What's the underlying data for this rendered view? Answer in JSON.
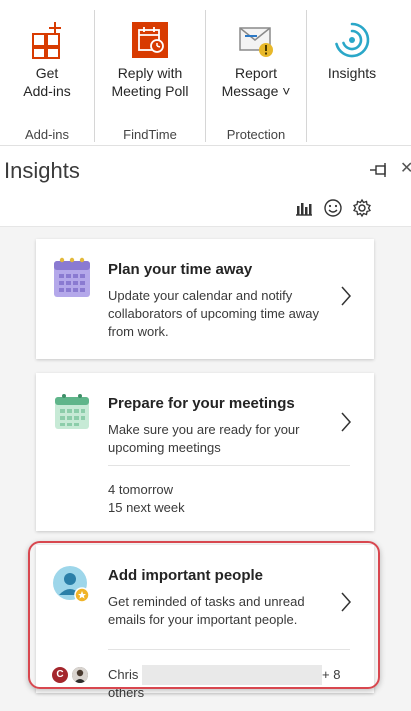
{
  "ribbon": {
    "groups": [
      {
        "label": "Add-ins",
        "buttons": [
          {
            "label": "Get\nAdd-ins",
            "icon": "get-addins-icon"
          }
        ]
      },
      {
        "label": "FindTime",
        "buttons": [
          {
            "label": "Reply with\nMeeting Poll",
            "icon": "meeting-poll-icon"
          }
        ]
      },
      {
        "label": "Protection",
        "buttons": [
          {
            "label": "Report\nMessage ˅",
            "icon": "report-message-icon"
          }
        ]
      },
      {
        "label": "",
        "buttons": [
          {
            "label": "Insights",
            "icon": "insights-icon"
          }
        ]
      }
    ]
  },
  "pane": {
    "title": "Insights",
    "toolbar_icons": [
      "bar-chart-icon",
      "smiley-icon",
      "gear-icon"
    ]
  },
  "cards": [
    {
      "title": "Plan your time away",
      "description": "Update your calendar and notify collaborators of upcoming time away from work.",
      "icon": "calendar-grid-icon"
    },
    {
      "title": "Prepare for your meetings",
      "description": "Make sure you are ready for your upcoming meetings",
      "stats": [
        "4 tomorrow",
        "15 next week"
      ],
      "icon": "calendar-icon"
    },
    {
      "title": "Add important people",
      "description": "Get reminded of tasks and unread emails for your important people.",
      "people": {
        "avatar_letter": "C",
        "name": "Chris",
        "more": "+ 8",
        "others": "others"
      },
      "icon": "person-star-icon"
    }
  ],
  "colors": {
    "accent_orange": "#d83b01",
    "insights_teal": "#2aa7c8",
    "highlight_red": "#d8474f",
    "calendar_purple": "#8a7ad1",
    "calendar_green": "#5fb58a"
  }
}
